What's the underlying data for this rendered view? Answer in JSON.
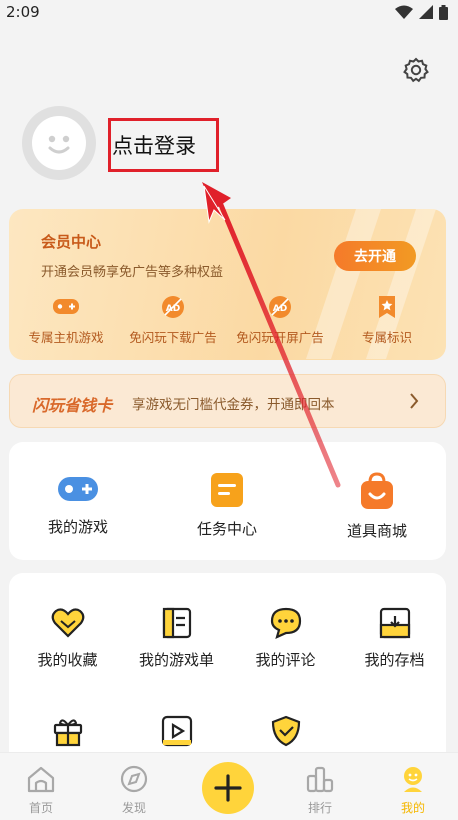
{
  "status_bar": {
    "time": "2:09"
  },
  "profile": {
    "login_label": "点击登录"
  },
  "vip": {
    "title": "会员中心",
    "description": "开通会员畅享免广告等多种权益",
    "button_label": "去开通",
    "perks": [
      {
        "label": "专属主机游戏",
        "icon": "gamepad-plus-icon"
      },
      {
        "label": "免闪玩下载广告",
        "icon": "no-ad-icon"
      },
      {
        "label": "免闪玩开屏广告",
        "icon": "no-ad-icon"
      },
      {
        "label": "专属标识",
        "icon": "badge-star-icon"
      }
    ],
    "accent": "#c85a1a"
  },
  "saving_card": {
    "title": "闪玩省钱卡",
    "description": "享游戏无门槛代金券，开通即回本"
  },
  "shortcuts": [
    {
      "label": "我的游戏",
      "icon": "gamepad-icon"
    },
    {
      "label": "任务中心",
      "icon": "task-icon"
    },
    {
      "label": "道具商城",
      "icon": "shopping-bag-icon"
    }
  ],
  "menu_items": [
    {
      "label": "我的收藏",
      "icon": "heart-icon"
    },
    {
      "label": "我的游戏单",
      "icon": "list-icon"
    },
    {
      "label": "我的评论",
      "icon": "comment-icon"
    },
    {
      "label": "我的存档",
      "icon": "archive-icon"
    },
    {
      "label": "",
      "icon": "gift-icon"
    },
    {
      "label": "",
      "icon": "video-icon"
    },
    {
      "label": "",
      "icon": "shield-icon"
    }
  ],
  "tabbar": {
    "tabs": [
      {
        "label": "首页",
        "icon": "home-icon"
      },
      {
        "label": "发现",
        "icon": "compass-icon"
      },
      {
        "label": "排行",
        "icon": "ranking-icon"
      },
      {
        "label": "我的",
        "icon": "profile-icon"
      }
    ],
    "active_color": "#f5b700",
    "fab_icon": "plus-icon"
  },
  "annotation": {
    "highlight_color": "#e0202a"
  }
}
